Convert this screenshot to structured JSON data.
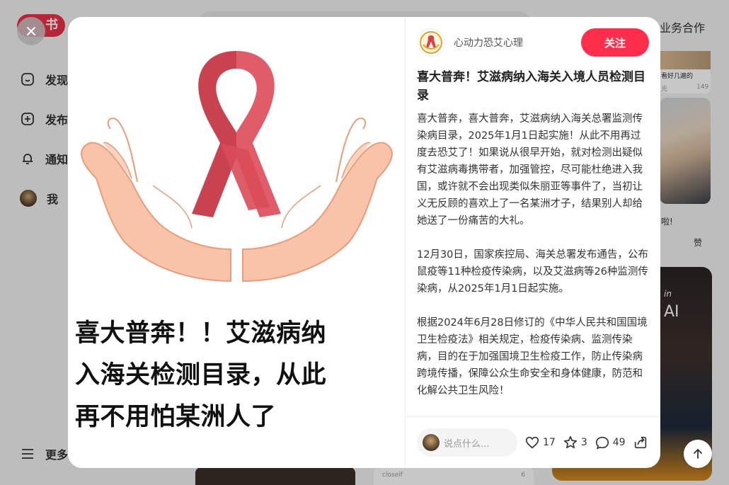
{
  "app": {
    "logo_text": "书",
    "business_link": "业务合作"
  },
  "sidebar": {
    "items": [
      {
        "label": "发现",
        "icon": "discover-icon"
      },
      {
        "label": "发布",
        "icon": "publish-icon"
      },
      {
        "label": "通知",
        "icon": "bell-icon"
      },
      {
        "label": "我",
        "icon": "avatar"
      }
    ],
    "more_label": "更多"
  },
  "background_feed": {
    "snippet_1": "看好几遍的",
    "snippet_1_stat": "149",
    "snippet_1_left": "光",
    "snippet_2": "啦!",
    "snippet_2_like": "赞",
    "card_user": "closeif",
    "card_likes": "6",
    "photo2_text_a": "in",
    "photo2_text_b": "AI"
  },
  "post": {
    "image_caption": [
      "喜大普奔！！艾滋病纳",
      "入海关检测目录，从此",
      "再不用怕某洲人了"
    ],
    "author": {
      "name": "心动力恐艾心理"
    },
    "follow_label": "关注",
    "title": "喜大普奔！艾滋病纳入海关入境人员检测目录",
    "paragraphs": [
      "喜大普奔，喜大普奔，艾滋病纳入海关总署监测传染病目录，2025年1月1日起实施！从此不用再过度去恐艾了！如果说从很早开始，就对检测出疑似有艾滋病毒携带者，加强管控，尽可能杜绝进入我国，或许就不会出现类似朱丽亚等事件了，当初让义无反顾的喜欢上了一名某洲才子，结果别人却给她送了一份痛苦的大礼。",
      "12月30日，国家疾控局、海关总署发布通告，公布鼠疫等11种检疫传染病，以及艾滋病等26种监测传染病，从2025年1月1日起实施。",
      "根据2024年6月28日修订的《中华人民共和国国境卫生检疫法》相关规定，检疫传染病、监测传染病，目的在于加强国境卫生检疫工作，防止传染病跨境传播，保障公众生命安全和身体健康，防范和化解公共卫生风险！"
    ],
    "comment_placeholder": "说点什么...",
    "stats": {
      "likes": "17",
      "collects": "3",
      "comments": "49"
    }
  },
  "colors": {
    "accent": "#ff2e4d",
    "ribbon": "#d6404f"
  }
}
